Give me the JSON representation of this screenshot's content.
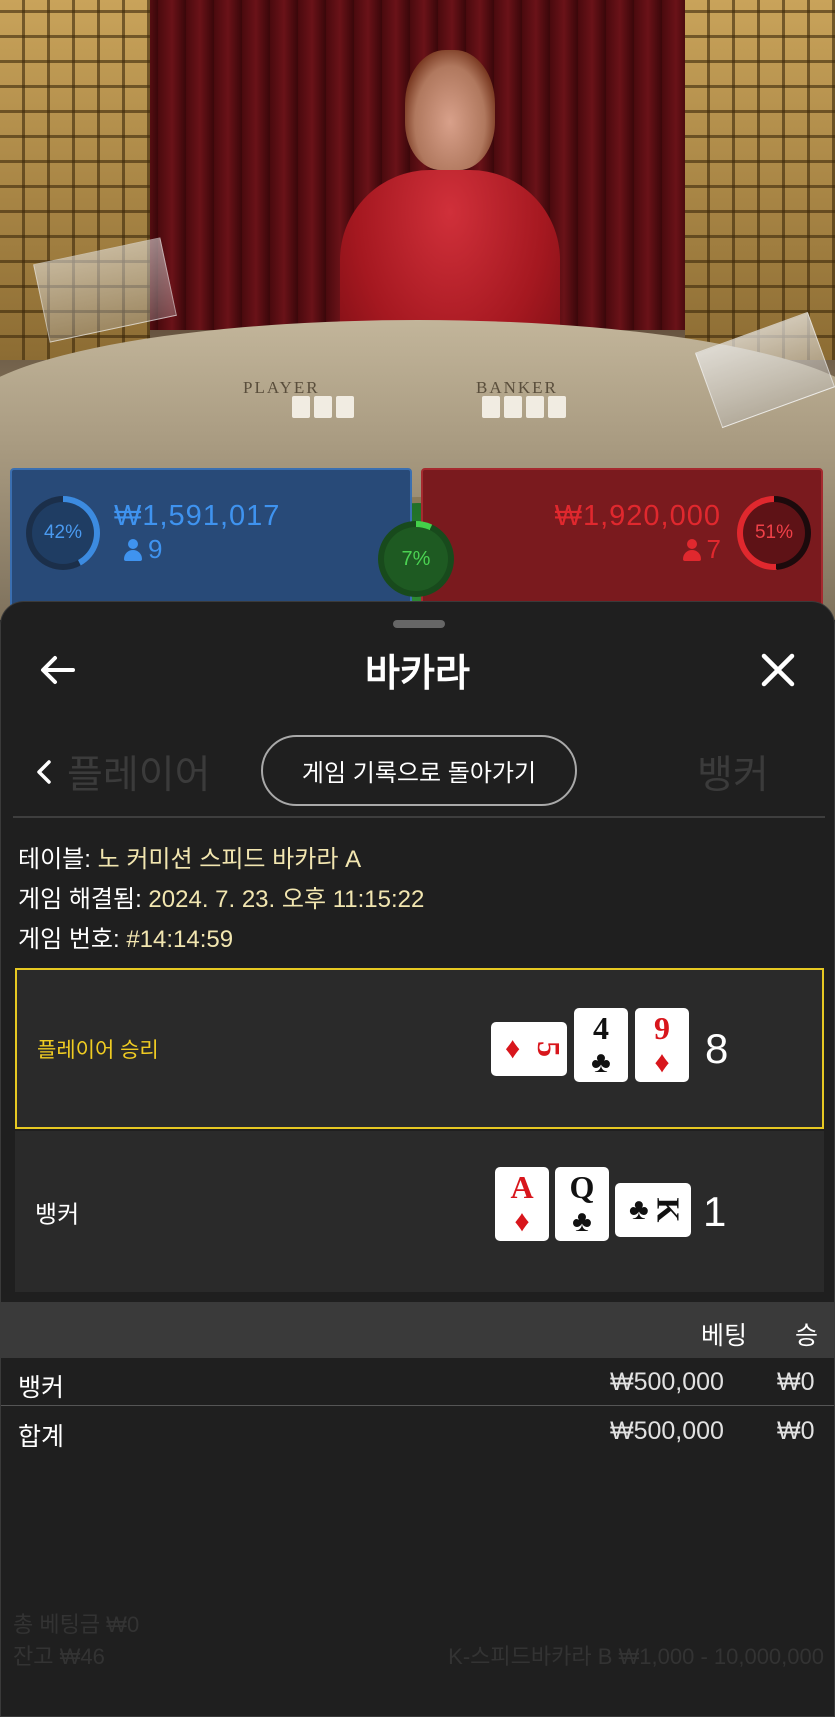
{
  "game_bg": {
    "table_labels": [
      "PLAYER",
      "BANKER"
    ],
    "player": {
      "percent": "42%",
      "amount": "₩1,591,017",
      "count": "9"
    },
    "banker": {
      "percent": "51%",
      "amount": "₩1,920,000",
      "count": "7"
    },
    "tie": {
      "percent": "7%"
    }
  },
  "sheet": {
    "title": "바카라",
    "back_to_history_label": "게임 기록으로 돌아가기",
    "info": {
      "table_label": "테이블:",
      "table_value": "노 커미션 스피드 바카라 A",
      "resolved_label": "게임 해결됨:",
      "resolved_value": "2024. 7. 23. 오후 11:15:22",
      "game_no_label": "게임 번호:",
      "game_no_value": "#14:14:59"
    },
    "results": [
      {
        "label": "플레이어 승리",
        "winner": true,
        "cards": [
          {
            "rank": "5",
            "suit": "♦",
            "color": "red",
            "orientation": "horizontal"
          },
          {
            "rank": "4",
            "suit": "♣",
            "color": "black",
            "orientation": "vertical"
          },
          {
            "rank": "9",
            "suit": "♦",
            "color": "red",
            "orientation": "vertical"
          }
        ],
        "score": "8"
      },
      {
        "label": "뱅커",
        "winner": false,
        "cards": [
          {
            "rank": "A",
            "suit": "♦",
            "color": "red",
            "orientation": "vertical"
          },
          {
            "rank": "Q",
            "suit": "♣",
            "color": "black",
            "orientation": "vertical"
          },
          {
            "rank": "K",
            "suit": "♣",
            "color": "black",
            "orientation": "horizontal"
          }
        ],
        "score": "1"
      }
    ],
    "bet_table": {
      "headers": {
        "bet": "베팅",
        "win": "승"
      },
      "rows": [
        {
          "name": "뱅커",
          "bet": "₩500,000",
          "win": "₩0"
        },
        {
          "name": "합계",
          "bet": "₩500,000",
          "win": "₩0"
        }
      ]
    }
  },
  "background_ghost_text": {
    "player_tab": "플레이어",
    "banker_tab": "뱅커",
    "total_bet": "총 베팅금 ₩0",
    "balance": "잔고 ₩46",
    "limits": "K-스피드바카라 B ₩1,000 - 10,000,000"
  }
}
